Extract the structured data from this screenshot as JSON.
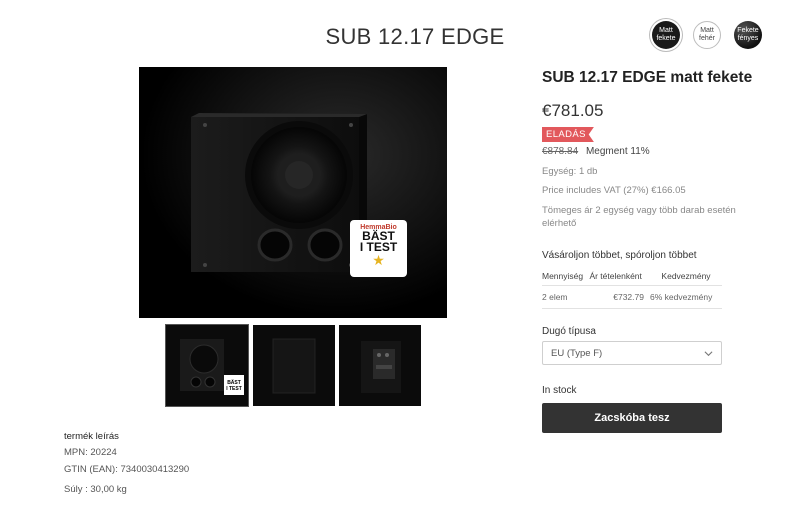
{
  "header": {
    "title": "SUB 12.17 EDGE"
  },
  "swatches": [
    {
      "label": "Matt fekete",
      "line1": "Matt",
      "line2": "fekete"
    },
    {
      "label": "Matt fehér",
      "line1": "Matt",
      "line2": "fehér"
    },
    {
      "label": "Fekete fényes",
      "line1": "Fekete",
      "line2": "fényes"
    }
  ],
  "award": {
    "brand": "HemmaBio",
    "line1": "BÄST",
    "line2": "I TEST"
  },
  "product": {
    "name": "SUB 12.17 EDGE matt fekete",
    "price": "€781.05",
    "sale_badge": "ELADÁS",
    "old_price": "€878.84",
    "savings": "Megment 11%",
    "unit": "Egység: 1 db",
    "vat": "Price includes VAT (27%) €166.05",
    "bulk_note": "Tömeges ár 2 egység vagy több darab esetén elérhető"
  },
  "buy_more": {
    "title": "Vásároljon többet, spóroljon többet",
    "headers": [
      "Mennyiség",
      "Ár tételenként",
      "Kedvezmény"
    ],
    "rows": [
      {
        "qty": "2 elem",
        "price": "€732.79",
        "discount": "6% kedvezmény"
      }
    ]
  },
  "plug": {
    "label": "Dugó típusa",
    "selected": "EU (Type F)"
  },
  "stock": "In stock",
  "cart_button": "Zacskóba tesz",
  "description": {
    "title": "termék leírás",
    "mpn": "MPN: 20224",
    "gtin": "GTIN (EAN): 7340030413290",
    "weight": "Súly : 30,00 kg"
  },
  "colors": {
    "sale": "#e2585c",
    "button": "#333333"
  },
  "icons": {
    "select": "chevron-down-icon"
  }
}
